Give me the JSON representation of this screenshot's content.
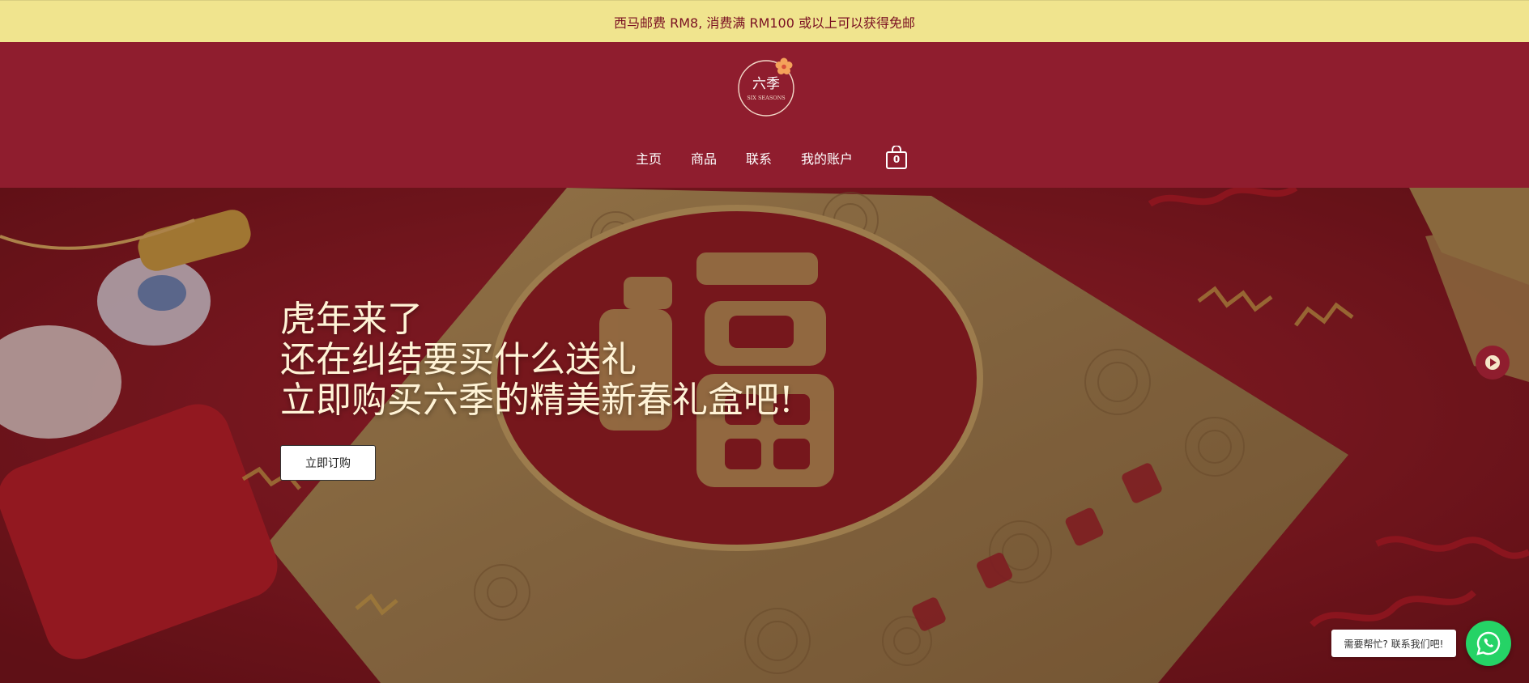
{
  "announcement": "西马邮费 RM8, 消费满 RM100 或以上可以获得免邮",
  "logo": {
    "chinese": "六季",
    "english": "SIX SEASONS"
  },
  "nav": {
    "items": [
      "主页",
      "商品",
      "联系",
      "我的账户"
    ],
    "cart_count": "0"
  },
  "hero": {
    "lines": [
      "虎年来了",
      "还在纠结要买什么送礼",
      "立即购买六季的精美新春礼盒吧!"
    ],
    "cta_label": "立即订购"
  },
  "chat": {
    "bubble_text": "需要帮忙? 联系我们吧!"
  },
  "colors": {
    "announcement_bg": "#f0e48e",
    "header_bg": "#8f1d2e",
    "whatsapp": "#25d366",
    "hero_text": "#fff3d6"
  },
  "icons": [
    "cart-icon",
    "play-arrow-icon",
    "whatsapp-icon",
    "flower-icon"
  ]
}
